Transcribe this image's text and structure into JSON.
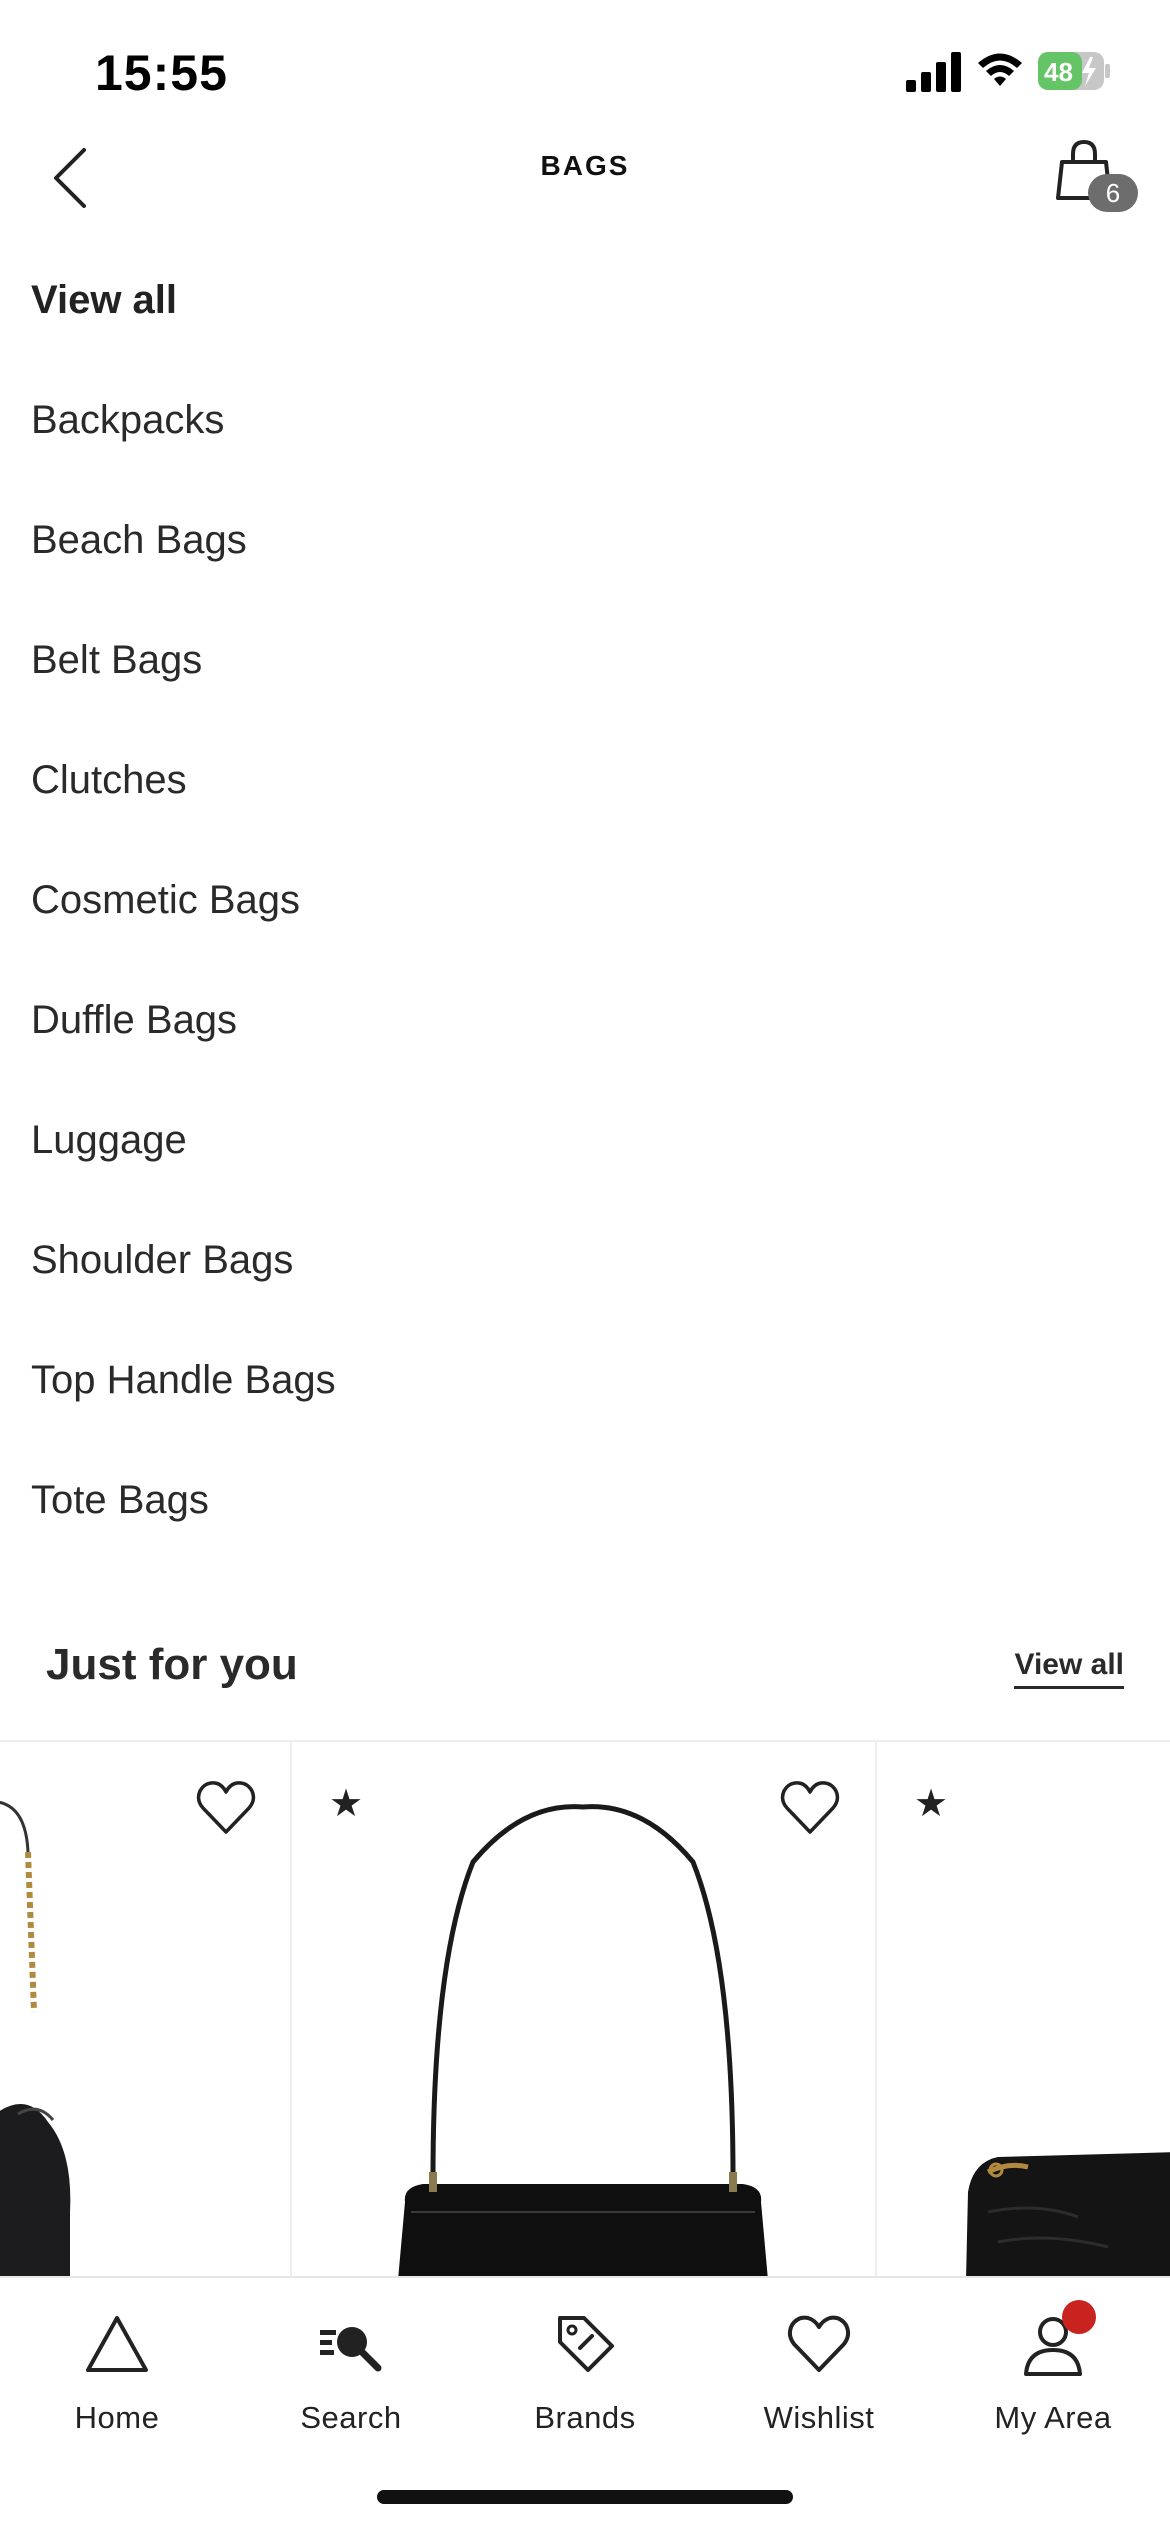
{
  "status_bar": {
    "time": "15:55",
    "battery_level": "48",
    "icons": [
      "signal-icon",
      "wifi-icon",
      "battery-charging-icon"
    ]
  },
  "header": {
    "title": "BAGS",
    "back_icon": "chevron-left-icon",
    "cart_icon": "shopping-bag-icon",
    "cart_count": "6"
  },
  "categories": [
    {
      "label": "View all",
      "active": true
    },
    {
      "label": "Backpacks"
    },
    {
      "label": "Beach Bags"
    },
    {
      "label": "Belt Bags"
    },
    {
      "label": "Clutches"
    },
    {
      "label": "Cosmetic Bags"
    },
    {
      "label": "Duffle Bags"
    },
    {
      "label": "Luggage"
    },
    {
      "label": "Shoulder Bags"
    },
    {
      "label": "Top Handle Bags"
    },
    {
      "label": "Tote Bags"
    }
  ],
  "just_for_you": {
    "title": "Just for you",
    "view_all_label": "View all"
  },
  "products": [
    {
      "image": "black-drawstring-bag-gold-chain",
      "icon": "heart-icon"
    },
    {
      "image": "black-leather-shoulder-bag",
      "badge_icon": "star-icon",
      "badge": "★",
      "icon": "heart-icon"
    },
    {
      "image": "black-quilted-chain-bag",
      "badge_icon": "star-icon",
      "badge": "★"
    }
  ],
  "tab_bar": {
    "items": [
      {
        "label": "Home",
        "icon": "triangle-home-icon"
      },
      {
        "label": "Search",
        "icon": "search-icon"
      },
      {
        "label": "Brands",
        "icon": "tag-icon"
      },
      {
        "label": "Wishlist",
        "icon": "heart-icon"
      },
      {
        "label": "My Area",
        "icon": "user-icon",
        "notification": true
      }
    ]
  },
  "colors": {
    "text": "#222222",
    "badge_bg": "#6d6d6d",
    "notification": "#c8231e",
    "battery_green": "#65c466",
    "divider": "#eeeeee"
  }
}
